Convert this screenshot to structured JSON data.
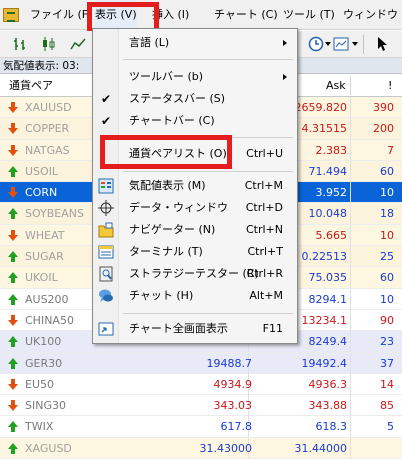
{
  "menubar": {
    "items": [
      "ファイル (F)",
      "表示 (V)",
      "挿入 (I)",
      "チャート (C)",
      "ツール (T)",
      "ウィンドウ (W)"
    ]
  },
  "panel": {
    "title": "気配値表示: 03:",
    "headers": {
      "symbol": "通貨ペア",
      "ask": "Ask",
      "extra": "!"
    }
  },
  "rows": [
    {
      "symbol": "XAUUSD",
      "bid": "",
      "ask": "2659.820",
      "spread": "390",
      "dir": "down",
      "dim": true
    },
    {
      "symbol": "COPPER",
      "bid": "",
      "ask": "4.31515",
      "spread": "200",
      "dir": "down",
      "dim": true
    },
    {
      "symbol": "NATGAS",
      "bid": "",
      "ask": "2.383",
      "spread": "7",
      "dir": "down",
      "dim": true
    },
    {
      "symbol": "USOIL",
      "bid": "",
      "ask": "71.494",
      "spread": "60",
      "dir": "up",
      "dim": true
    },
    {
      "symbol": "CORN",
      "bid": "",
      "ask": "3.952",
      "spread": "10",
      "dir": "down",
      "dim": false,
      "selected": true
    },
    {
      "symbol": "SOYBEANS",
      "bid": "",
      "ask": "10.048",
      "spread": "18",
      "dir": "up",
      "dim": true
    },
    {
      "symbol": "WHEAT",
      "bid": "",
      "ask": "5.665",
      "spread": "10",
      "dir": "down",
      "dim": true
    },
    {
      "symbol": "SUGAR",
      "bid": "",
      "ask": "0.22513",
      "spread": "25",
      "dir": "up",
      "dim": true
    },
    {
      "symbol": "UKOIL",
      "bid": "",
      "ask": "75.035",
      "spread": "60",
      "dir": "up",
      "dim": true
    },
    {
      "symbol": "AUS200",
      "bid": "",
      "ask": "8294.1",
      "spread": "10",
      "dir": "up",
      "dim": false
    },
    {
      "symbol": "CHINA50",
      "bid": "",
      "ask": "13234.1",
      "spread": "90",
      "dir": "down",
      "dim": false
    },
    {
      "symbol": "UK100",
      "bid": "",
      "ask": "8249.4",
      "spread": "23",
      "dir": "up",
      "dim": false
    },
    {
      "symbol": "GER30",
      "bid": "19488.7",
      "ask": "19492.4",
      "spread": "37",
      "dir": "up",
      "dim": false
    },
    {
      "symbol": "EU50",
      "bid": "4934.9",
      "ask": "4936.3",
      "spread": "14",
      "dir": "down",
      "dim": false
    },
    {
      "symbol": "SING30",
      "bid": "343.03",
      "ask": "343.88",
      "spread": "85",
      "dir": "down",
      "dim": false
    },
    {
      "symbol": "TWIX",
      "bid": "617.8",
      "ask": "618.3",
      "spread": "5",
      "dir": "up",
      "dim": false
    },
    {
      "symbol": "XAGUSD",
      "bid": "31.43000",
      "ask": "31.44000",
      "spread": "",
      "dir": "up",
      "dim": true
    }
  ],
  "dropdown": {
    "items": [
      {
        "label": "言語 (L)",
        "shortcut": "",
        "submenu": true,
        "check": false,
        "icon": ""
      },
      {
        "label": "ツールバー (b)",
        "shortcut": "",
        "submenu": true,
        "check": false,
        "icon": ""
      },
      {
        "label": "ステータスバー (S)",
        "shortcut": "",
        "submenu": false,
        "check": true,
        "icon": ""
      },
      {
        "label": "チャートバー (C)",
        "shortcut": "",
        "submenu": false,
        "check": true,
        "icon": ""
      },
      {
        "label": "通貨ペアリスト (O)",
        "shortcut": "Ctrl+U",
        "submenu": false,
        "check": false,
        "icon": ""
      },
      {
        "label": "気配値表示 (M)",
        "shortcut": "Ctrl+M",
        "submenu": false,
        "check": false,
        "icon": "market-watch-icon"
      },
      {
        "label": "データ・ウィンドウ",
        "shortcut": "Ctrl+D",
        "submenu": false,
        "check": false,
        "icon": "crosshair-icon"
      },
      {
        "label": "ナビゲーター (N)",
        "shortcut": "Ctrl+N",
        "submenu": false,
        "check": false,
        "icon": "navigator-icon"
      },
      {
        "label": "ターミナル (T)",
        "shortcut": "Ctrl+T",
        "submenu": false,
        "check": false,
        "icon": "terminal-icon"
      },
      {
        "label": "ストラテジーテスター (R)",
        "shortcut": "Ctrl+R",
        "submenu": false,
        "check": false,
        "icon": "tester-icon"
      },
      {
        "label": "チャット (H)",
        "shortcut": "Alt+M",
        "submenu": false,
        "check": false,
        "icon": "chat-icon"
      },
      {
        "label": "チャート全画面表示",
        "shortcut": "F11",
        "submenu": false,
        "check": false,
        "icon": "fullscreen-icon"
      }
    ]
  },
  "colors": {
    "highlight_box": "#e41e1e",
    "selected_row": "#0a64d8",
    "up_arrow": "#22a022",
    "down_arrow": "#e25010"
  }
}
